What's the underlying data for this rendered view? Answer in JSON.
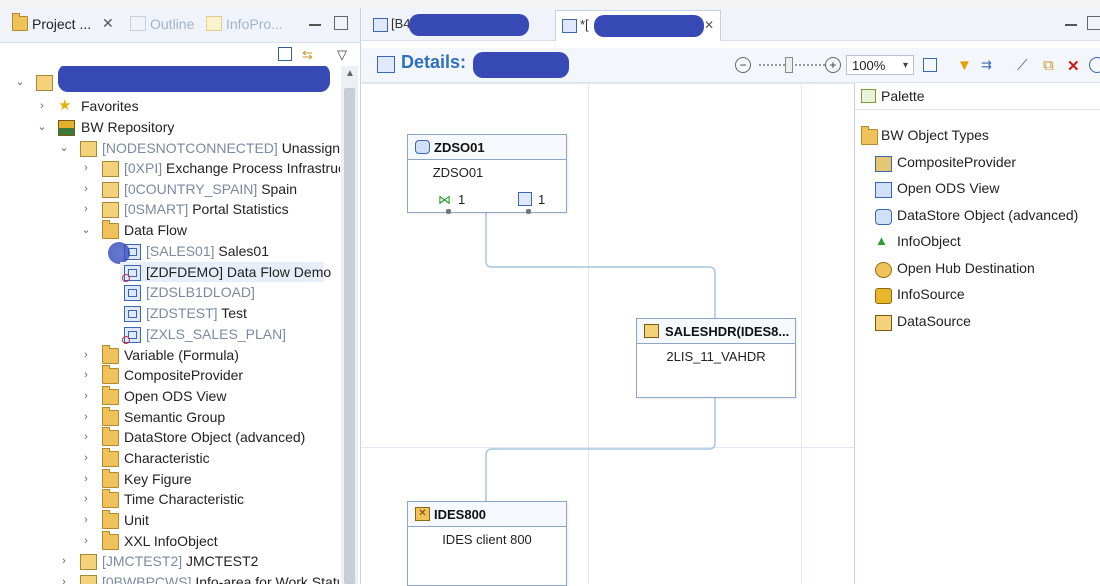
{
  "left_tabs": {
    "project": "Project ...",
    "outline": "Outline",
    "infopro": "InfoPro..."
  },
  "tree": {
    "root": "",
    "favorites": "Favorites",
    "bw_repo": "BW Repository",
    "nodes_tech": "[NODESNOTCONNECTED]",
    "nodes_name": "Unassigned",
    "oxpi_tech": "[0XPI]",
    "oxpi_name": "Exchange Process Infrastructu",
    "ocountry_tech": "[0COUNTRY_SPAIN]",
    "ocountry_name": "Spain",
    "osmart_tech": "[0SMART]",
    "osmart_name": "Portal Statistics",
    "dataflow": "Data Flow",
    "sales01_tech": "[SALES01]",
    "sales01_name": "Sales01",
    "zdfdemo": "[ZDFDEMO] Data Flow Demo",
    "zdslb": "[ZDSLB1DLOAD]",
    "zdstest_tech": "[ZDSTEST]",
    "zdstest_name": "Test",
    "zxls": "[ZXLS_SALES_PLAN]",
    "variable": "Variable (Formula)",
    "composite": "CompositeProvider",
    "openods": "Open ODS View",
    "semantic": "Semantic Group",
    "datastore": "DataStore Object (advanced)",
    "characteristic": "Characteristic",
    "keyfigure": "Key Figure",
    "timechar": "Time Characteristic",
    "unit": "Unit",
    "xxl": "XXL InfoObject",
    "jmctest_tech": "[JMCTEST2]",
    "jmctest_name": "JMCTEST2",
    "obwb_tech": "[0BWBPCWS]",
    "obwb_name": "Info-area for Work Status"
  },
  "editor": {
    "tab1": "[B4",
    "tab2": "*[",
    "details_label": "Details:",
    "zoom": "100%"
  },
  "nodes": {
    "zdso_title": "ZDSO01",
    "zdso_desc": "ZDSO01",
    "zdso_in": "1",
    "zdso_out": "1",
    "saleshdr_title": "SALESHDR(IDES8...",
    "saleshdr_desc": "2LIS_11_VAHDR",
    "ides_title": "IDES800",
    "ides_desc": "IDES client 800"
  },
  "palette": {
    "title": "Palette",
    "group": "BW Object Types",
    "items": [
      "CompositeProvider",
      "Open ODS View",
      "DataStore Object (advanced)",
      "InfoObject",
      "Open Hub Destination",
      "InfoSource",
      "DataSource"
    ]
  },
  "colors": {
    "accent": "#2f6fbf",
    "folder": "#f0c35a",
    "redaction": "#2c3fb0"
  }
}
